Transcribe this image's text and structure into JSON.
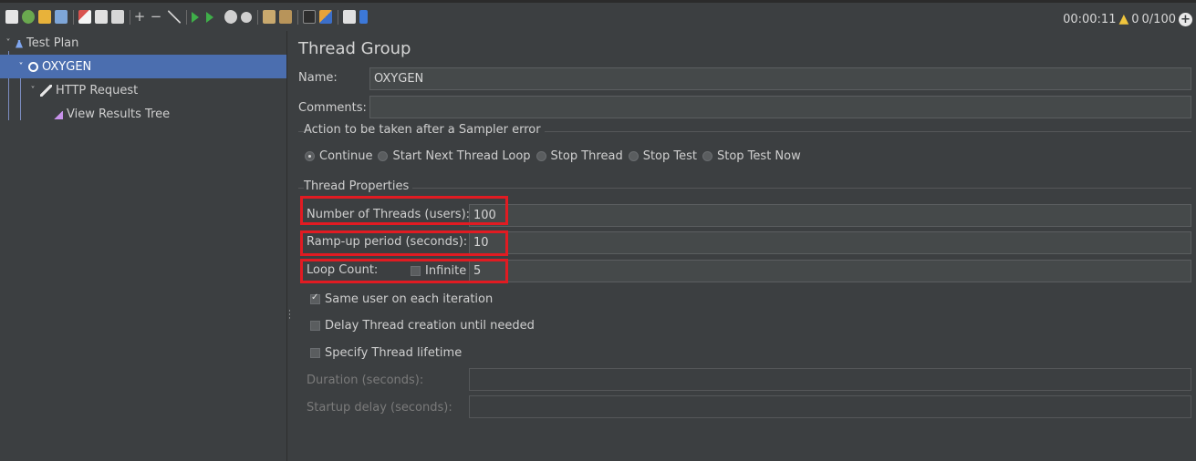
{
  "toolbar": {
    "icons": [
      "new-icon",
      "templates-icon",
      "open-icon",
      "save-icon",
      "cut-icon",
      "copy-icon",
      "paste-icon",
      "expand-icon",
      "collapse-icon",
      "toggle-icon",
      "start-icon",
      "start-no-pauses-icon",
      "stop-icon",
      "shutdown-icon",
      "clear-icon",
      "clear-all-icon",
      "search-icon",
      "reset-search-icon",
      "function-helper-icon",
      "help-icon"
    ],
    "glyphs": {
      "expand": "+",
      "collapse": "−"
    }
  },
  "status": {
    "elapsed": "00:00:11",
    "warning_count": "0",
    "threads": "0/100"
  },
  "tree": {
    "items": [
      {
        "label": "Test Plan",
        "icon": "test-plan-icon"
      },
      {
        "label": "OXYGEN",
        "icon": "thread-group-icon"
      },
      {
        "label": "HTTP Request",
        "icon": "http-request-icon"
      },
      {
        "label": "View Results Tree",
        "icon": "view-results-tree-icon"
      }
    ]
  },
  "panel": {
    "title": "Thread Group",
    "name_label": "Name:",
    "name_value": "OXYGEN",
    "comments_label": "Comments:",
    "comments_value": "",
    "sampler_error": {
      "title": "Action to be taken after a Sampler error",
      "options": [
        "Continue",
        "Start Next Thread Loop",
        "Stop Thread",
        "Stop Test",
        "Stop Test Now"
      ],
      "selected": "Continue"
    },
    "thread_properties": {
      "title": "Thread Properties",
      "threads_label": "Number of Threads (users):",
      "threads_value": "100",
      "rampup_label": "Ramp-up period (seconds):",
      "rampup_value": "10",
      "loop_label": "Loop Count:",
      "infinite_label": "Infinite",
      "infinite_checked": false,
      "loop_value": "5",
      "same_user_label": "Same user on each iteration",
      "same_user_checked": true,
      "delay_label": "Delay Thread creation until needed",
      "delay_checked": false,
      "lifetime_label": "Specify Thread lifetime",
      "lifetime_checked": false,
      "duration_label": "Duration (seconds):",
      "duration_value": "",
      "startup_label": "Startup delay (seconds):",
      "startup_value": ""
    }
  },
  "colors": {
    "selection": "#4b6eaf",
    "highlight": "#e11b22",
    "background": "#3c3f41"
  }
}
